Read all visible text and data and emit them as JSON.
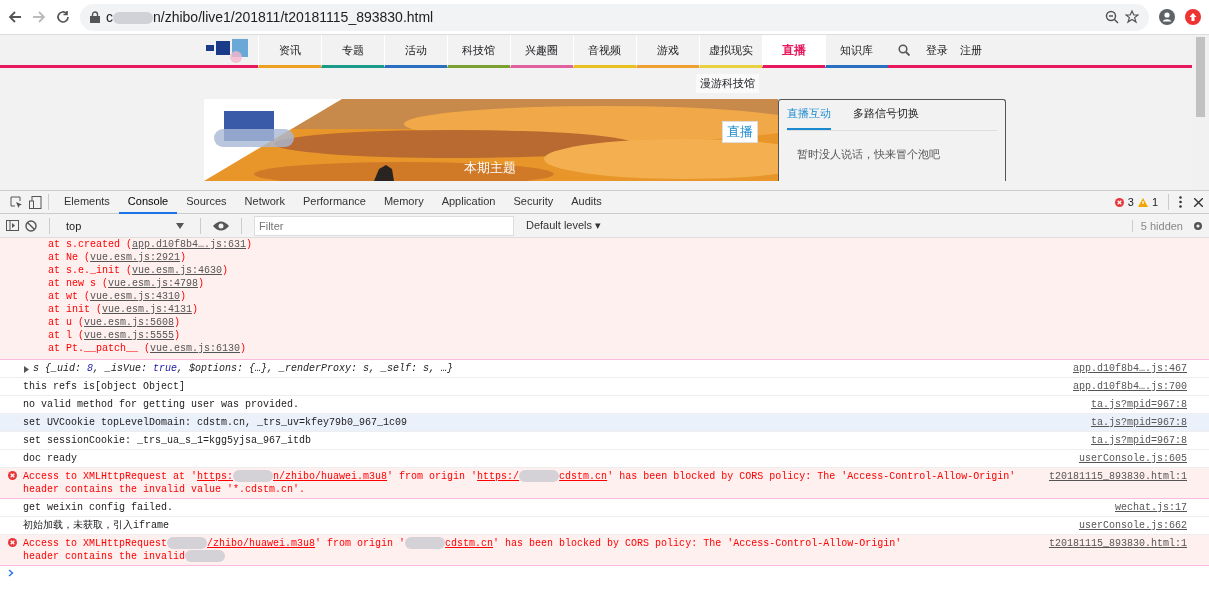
{
  "browser": {
    "url_parts": [
      "c",
      "n/zhibo/live1/201811/t20181115_893830.html"
    ]
  },
  "site_nav": {
    "items": [
      {
        "label": "资讯",
        "color": "#f0a020",
        "selected": false
      },
      {
        "label": "专题",
        "color": "#1a9a8a",
        "selected": false
      },
      {
        "label": "活动",
        "color": "#2a6fc0",
        "selected": false
      },
      {
        "label": "科技馆",
        "color": "#7aa030",
        "selected": false
      },
      {
        "label": "兴趣圈",
        "color": "#e060a0",
        "selected": false
      },
      {
        "label": "音视频",
        "color": "#e8c020",
        "selected": false
      },
      {
        "label": "游戏",
        "color": "#f0a030",
        "selected": false
      },
      {
        "label": "虚拟现实",
        "color": "#e8d040",
        "selected": false
      },
      {
        "label": "直播",
        "color": "#e8185c",
        "selected": true
      },
      {
        "label": "知识库",
        "color": "#2a6fc0",
        "selected": false
      }
    ],
    "login": "登录",
    "register": "注册",
    "submenu": "漫游科技馆"
  },
  "banner": {
    "badge": "直播",
    "caption": "本期主题"
  },
  "side_panel": {
    "tabs": [
      {
        "label": "直播互动",
        "selected": true
      },
      {
        "label": "多路信号切换",
        "selected": false
      }
    ],
    "message": "暂时没人说话，快来冒个泡吧"
  },
  "devtools": {
    "tabs": [
      {
        "label": "Elements",
        "selected": false
      },
      {
        "label": "Console",
        "selected": true
      },
      {
        "label": "Sources",
        "selected": false
      },
      {
        "label": "Network",
        "selected": false
      },
      {
        "label": "Performance",
        "selected": false
      },
      {
        "label": "Memory",
        "selected": false
      },
      {
        "label": "Application",
        "selected": false
      },
      {
        "label": "Security",
        "selected": false
      },
      {
        "label": "Audits",
        "selected": false
      }
    ],
    "error_count": "3",
    "warning_count": "1",
    "context": "top",
    "filter_placeholder": "Filter",
    "levels": "Default levels ▾",
    "hidden": "5 hidden"
  },
  "messages": [
    {
      "kind": "stack",
      "selected": false,
      "lines": [
        [
          {
            "kind": "text",
            "text": "at s.created ("
          },
          {
            "kind": "link",
            "text": "app.d10f8b4….js:631"
          },
          {
            "kind": "text",
            "text": ")"
          }
        ],
        [
          {
            "kind": "text",
            "text": "at Ne ("
          },
          {
            "kind": "link",
            "text": "vue.esm.js:2921"
          },
          {
            "kind": "text",
            "text": ")"
          }
        ],
        [
          {
            "kind": "text",
            "text": "at s.e._init ("
          },
          {
            "kind": "link",
            "text": "vue.esm.js:4630"
          },
          {
            "kind": "text",
            "text": ")"
          }
        ],
        [
          {
            "kind": "text",
            "text": "at new s ("
          },
          {
            "kind": "link",
            "text": "vue.esm.js:4798"
          },
          {
            "kind": "text",
            "text": ")"
          }
        ],
        [
          {
            "kind": "text",
            "text": "at wt ("
          },
          {
            "kind": "link",
            "text": "vue.esm.js:4310"
          },
          {
            "kind": "text",
            "text": ")"
          }
        ],
        [
          {
            "kind": "text",
            "text": "at init ("
          },
          {
            "kind": "link",
            "text": "vue.esm.js:4131"
          },
          {
            "kind": "text",
            "text": ")"
          }
        ],
        [
          {
            "kind": "text",
            "text": "at u ("
          },
          {
            "kind": "link",
            "text": "vue.esm.js:5608"
          },
          {
            "kind": "text",
            "text": ")"
          }
        ],
        [
          {
            "kind": "text",
            "text": "at l ("
          },
          {
            "kind": "link",
            "text": "vue.esm.js:5555"
          },
          {
            "kind": "text",
            "text": ")"
          }
        ],
        [
          {
            "kind": "text",
            "text": "at Pt.__patch__ ("
          },
          {
            "kind": "link",
            "text": "vue.esm.js:6130"
          },
          {
            "kind": "text",
            "text": ")"
          }
        ]
      ]
    },
    {
      "kind": "object",
      "selected": false,
      "source": "app.d10f8b4….js:467",
      "lines": [
        [
          {
            "kind": "text",
            "text": "s {_uid: "
          },
          {
            "kind": "value",
            "text": "8"
          },
          {
            "kind": "text",
            "text": ", _isVue: "
          },
          {
            "kind": "value",
            "text": "true"
          },
          {
            "kind": "text",
            "text": ", $options: {…}, _renderProxy: s, _self: s, …}"
          }
        ]
      ]
    },
    {
      "kind": "log",
      "selected": false,
      "source": "app.d10f8b4….js:700",
      "lines": [
        [
          {
            "kind": "text",
            "text": "this refs is[object Object]"
          }
        ]
      ]
    },
    {
      "kind": "log",
      "selected": false,
      "source": "ta.js?mpid=967:8",
      "lines": [
        [
          {
            "kind": "text",
            "text": "no valid method for getting user was provided."
          }
        ]
      ]
    },
    {
      "kind": "log",
      "selected": true,
      "source": "ta.js?mpid=967:8",
      "lines": [
        [
          {
            "kind": "text",
            "text": "set UVCookie topLevelDomain: cdstm.cn, _trs_uv=kfey79b0_967_1c09"
          }
        ]
      ]
    },
    {
      "kind": "log",
      "selected": false,
      "source": "ta.js?mpid=967:8",
      "lines": [
        [
          {
            "kind": "text",
            "text": "set sessionCookie: _trs_ua_s_1=kgg5yjsa_967_itdb"
          }
        ]
      ]
    },
    {
      "kind": "log",
      "selected": false,
      "source": "userConsole.js:605",
      "lines": [
        [
          {
            "kind": "text",
            "text": "doc ready"
          }
        ]
      ]
    },
    {
      "kind": "error",
      "selected": false,
      "source": "t20181115_893830.html:1",
      "lines": [
        [
          {
            "kind": "text",
            "text": "Access to XMLHttpRequest at '"
          },
          {
            "kind": "link",
            "text": "https:"
          },
          {
            "kind": "blur"
          },
          {
            "kind": "link",
            "text": "n/zhibo/huawei.m3u8"
          },
          {
            "kind": "text",
            "text": "' from origin '"
          },
          {
            "kind": "link",
            "text": "https:/"
          },
          {
            "kind": "blur"
          },
          {
            "kind": "link",
            "text": "cdstm.cn"
          },
          {
            "kind": "text",
            "text": "' has been blocked by CORS policy: The 'Access-Control-Allow-Origin'"
          }
        ],
        [
          {
            "kind": "text",
            "text": "header contains the invalid value '*.cdstm.cn'."
          }
        ]
      ]
    },
    {
      "kind": "log",
      "selected": false,
      "source": "wechat.js:17",
      "lines": [
        [
          {
            "kind": "text",
            "text": "get weixin config failed."
          }
        ]
      ]
    },
    {
      "kind": "log",
      "selected": false,
      "source": "userConsole.js:662",
      "lines": [
        [
          {
            "kind": "text",
            "text": "初始加载，未获取，引入iframe"
          }
        ]
      ]
    },
    {
      "kind": "error",
      "selected": false,
      "source": "t20181115_893830.html:1",
      "lines": [
        [
          {
            "kind": "text",
            "text": "Access to XMLHttpRequest"
          },
          {
            "kind": "blur"
          },
          {
            "kind": "link",
            "text": "/zhibo/huawei.m3u8"
          },
          {
            "kind": "text",
            "text": "' from origin '"
          },
          {
            "kind": "blur"
          },
          {
            "kind": "link",
            "text": "cdstm.cn"
          },
          {
            "kind": "text",
            "text": "' has been blocked by CORS policy: The 'Access-Control-Allow-Origin'"
          }
        ],
        [
          {
            "kind": "text",
            "text": "header contains the invalid"
          },
          {
            "kind": "blur"
          }
        ]
      ]
    }
  ]
}
